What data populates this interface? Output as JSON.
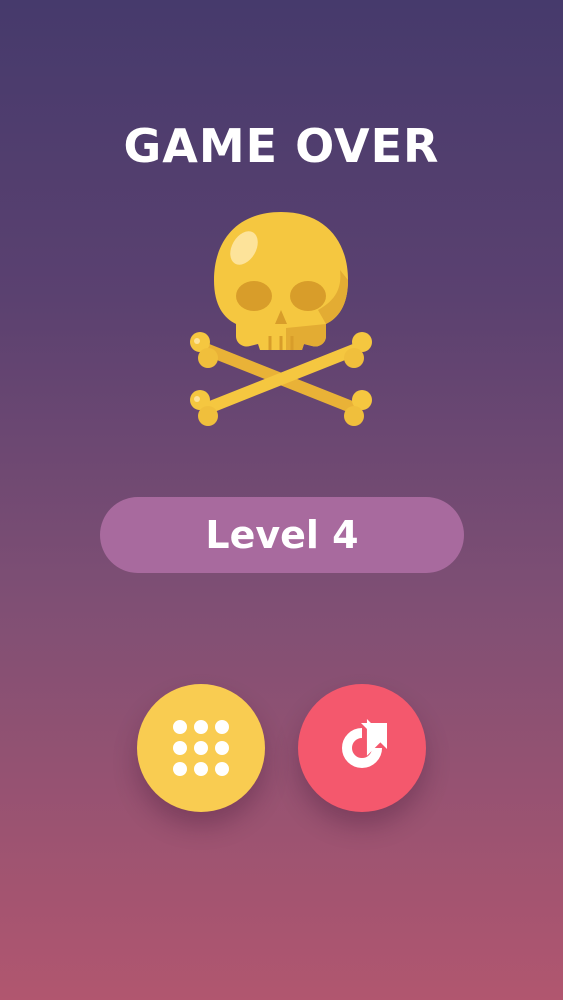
{
  "game_over": {
    "title": "GAME OVER",
    "icon": "skull-crossbones-icon",
    "level_label": "Level 4"
  },
  "buttons": {
    "levels": {
      "icon": "grid-dots-icon",
      "color": "#f9cc51"
    },
    "restart": {
      "icon": "restart-arrow-icon",
      "color": "#f4586d"
    }
  },
  "colors": {
    "background_top": "#463a6c",
    "background_bottom": "#b1566f",
    "level_pill": "#a86a9e",
    "skull": "#f5c740"
  }
}
